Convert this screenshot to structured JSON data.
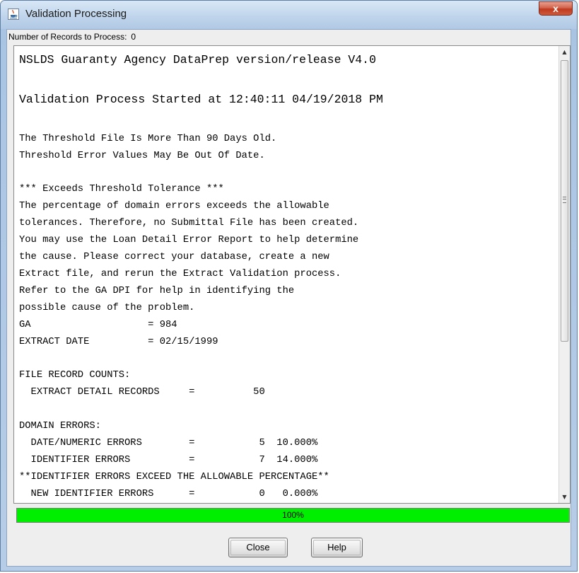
{
  "window": {
    "title": "Validation Processing",
    "close_label": "x",
    "icon": "java-cup-icon"
  },
  "records": {
    "label": "Number of Records to Process:",
    "value": "0"
  },
  "text_lines": [
    "NSLDS Guaranty Agency DataPrep version/release V4.0",
    "Validation Process Started at 12:40:11 04/19/2018 PM",
    "The Threshold File Is More Than 90 Days Old.",
    "Threshold Error Values May Be Out Of Date.",
    "*** Exceeds Threshold Tolerance ***",
    "The percentage of domain errors exceeds the allowable",
    "tolerances. Therefore, no Submittal File has been created.",
    "You may use the Loan Detail Error Report to help determine",
    "the cause. Please correct your database, create a new",
    "Extract file, and rerun the Extract Validation process.",
    "Refer to the GA DPI for help in identifying the",
    "possible cause of the problem.",
    "GA                    = 984",
    "EXTRACT DATE          = 02/15/1999",
    "FILE RECORD COUNTS:",
    "  EXTRACT DETAIL RECORDS     =          50",
    "DOMAIN ERRORS:",
    "  DATE/NUMERIC ERRORS        =           5  10.000%",
    "  IDENTIFIER ERRORS          =           7  14.000%",
    "**IDENTIFIER ERRORS EXCEED THE ALLOWABLE PERCENTAGE**",
    "  NEW IDENTIFIER ERRORS      =           0   0.000%"
  ],
  "progress": {
    "label": "100%",
    "value": 1.0,
    "fill_color": "#00ee00"
  },
  "buttons": {
    "close": "Close",
    "help": "Help"
  }
}
